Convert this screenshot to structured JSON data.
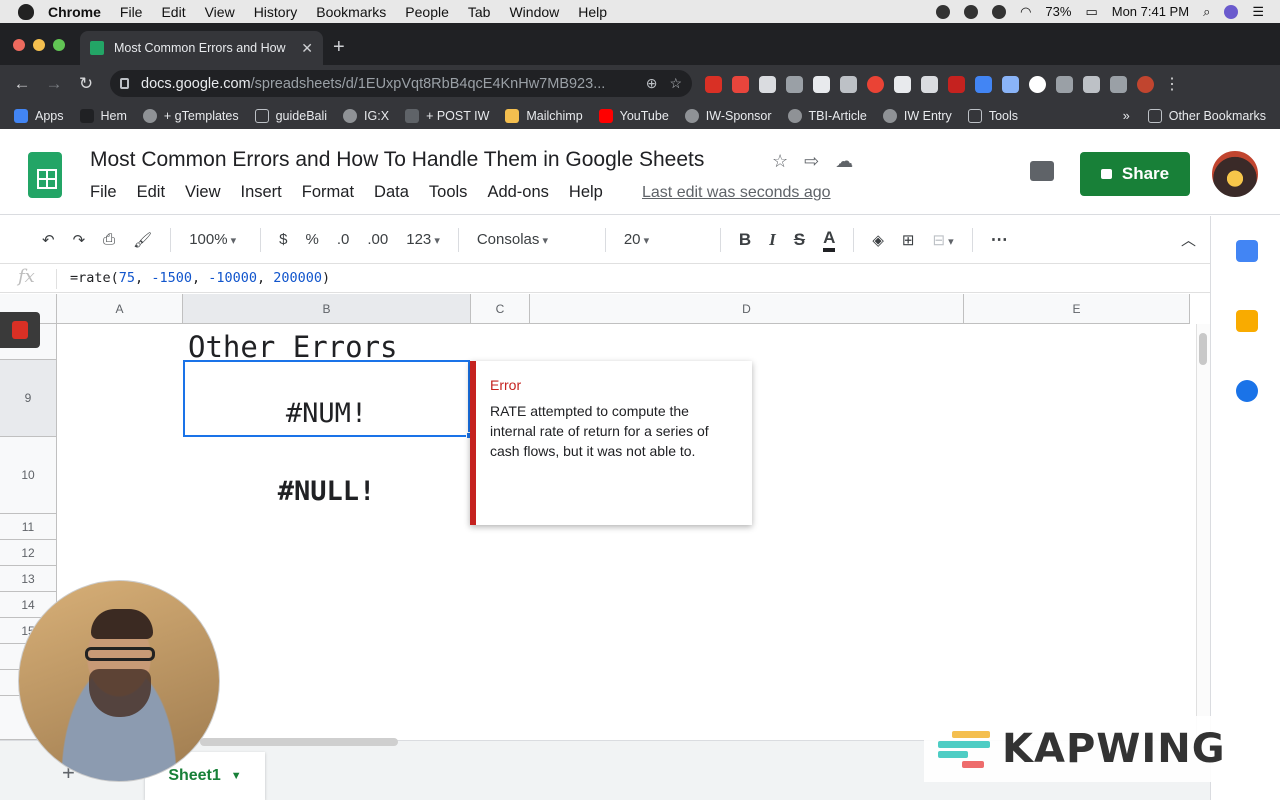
{
  "menubar": {
    "app": "Chrome",
    "items": [
      "File",
      "Edit",
      "View",
      "History",
      "Bookmarks",
      "People",
      "Tab",
      "Window",
      "Help"
    ],
    "battery": "73%",
    "clock": "Mon 7:41 PM"
  },
  "browser": {
    "tab_title": "Most Common Errors and How",
    "url_host": "docs.google.com",
    "url_path": "/spreadsheets/d/1EUxpVqt8RbB4qcE4KnHw7MB923..."
  },
  "bookmarks": {
    "items": [
      "Apps",
      "Hem",
      "+ gTemplates",
      "guideBali",
      "IG:X",
      "+ POST IW",
      "Mailchimp",
      "YouTube",
      "IW-Sponsor",
      "TBI-Article",
      "IW Entry",
      "Tools"
    ],
    "more": "»",
    "other": "Other Bookmarks"
  },
  "doc": {
    "title": "Most Common Errors and How To Handle Them in Google Sheets",
    "menu": [
      "File",
      "Edit",
      "View",
      "Insert",
      "Format",
      "Data",
      "Tools",
      "Add-ons",
      "Help"
    ],
    "last_edit": "Last edit was seconds ago",
    "share_label": "Share"
  },
  "format_toolbar": {
    "zoom": "100%",
    "currency": "$",
    "percent": "%",
    "dec_decrease": ".0",
    "dec_increase": ".00",
    "more_formats": "123",
    "font": "Consolas",
    "font_size": "20",
    "bold": "B",
    "italic": "I",
    "strike": "S",
    "text_color": "A",
    "more": "⋯"
  },
  "formula_bar": {
    "fx": "fx",
    "prefix": "=rate(",
    "arg1": "75",
    "sep1": ", ",
    "arg2": "-1500",
    "sep2": ", ",
    "arg3": "-10000",
    "sep3": ", ",
    "arg4": "200000",
    "suffix": ")"
  },
  "grid": {
    "columns": [
      "A",
      "B",
      "C",
      "D",
      "E"
    ],
    "rows": [
      "9",
      "10",
      "11",
      "12",
      "13",
      "14",
      "15"
    ],
    "heading_text": "Other Errors",
    "cell_b9": "#NUM!",
    "cell_b10": "#NULL!"
  },
  "error_tooltip": {
    "title": "Error",
    "message": "RATE attempted to compute the internal rate of return for a series of cash flows, but it was not able to."
  },
  "sheets_bar": {
    "add": "+",
    "sheet_name": "Sheet1"
  },
  "watermark": "KAPWING",
  "colors": {
    "sheets_green": "#188038",
    "selection_blue": "#1a73e8",
    "error_red": "#c5221f",
    "formula_number": "#1155cc"
  }
}
